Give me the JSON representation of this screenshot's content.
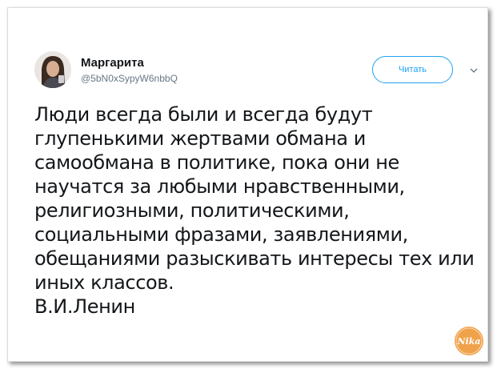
{
  "tweet": {
    "display_name": "Маргарита",
    "handle": "@5bN0xSypyW6nbbQ",
    "follow_label": "Читать",
    "text_lines": [
      "Люди всегда были и всегда будут",
      "глупенькими жертвами обмана и",
      "самообмана в политике, пока они не",
      "научатся за любыми нравственными,",
      "религиозными, политическими,",
      "социальными фразами, заявлениями,",
      "обещаниями разыскивать интересы тех или",
      "иных классов."
    ],
    "attribution": "В.И.Ленин"
  },
  "watermark": {
    "text": "Nika"
  },
  "colors": {
    "accent": "#1da1f2",
    "text": "#14171a",
    "secondary_text": "#657786",
    "watermark": "#f0a24a"
  },
  "icons": {
    "menu": "chevron-down-icon"
  }
}
